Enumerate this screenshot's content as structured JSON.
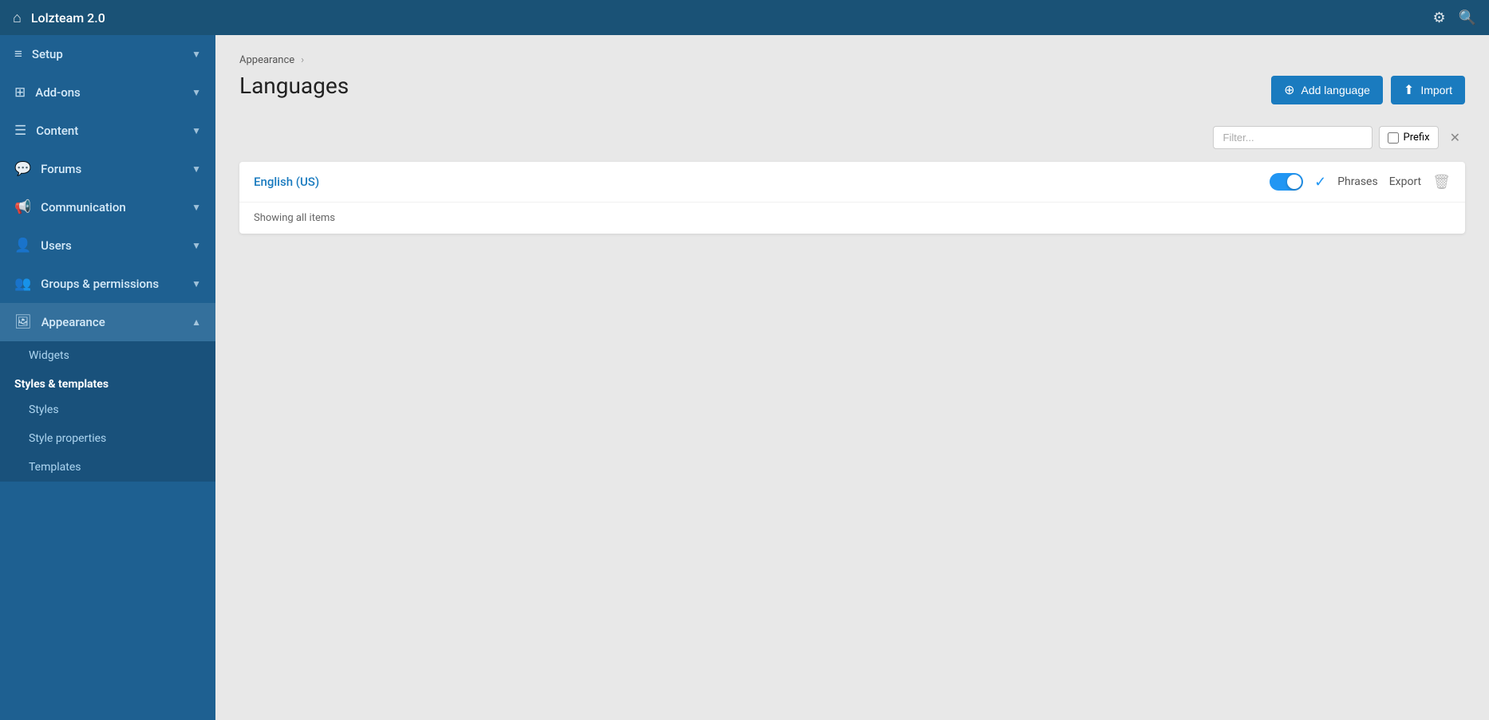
{
  "topbar": {
    "title": "Lolzteam 2.0",
    "home_icon": "⌂",
    "settings_icon": "⚙",
    "search_icon": "🔍"
  },
  "sidebar": {
    "items": [
      {
        "id": "setup",
        "icon": "≡",
        "label": "Setup",
        "expanded": false
      },
      {
        "id": "addons",
        "icon": "⊞",
        "label": "Add-ons",
        "expanded": false
      },
      {
        "id": "content",
        "icon": "☰",
        "label": "Content",
        "expanded": false
      },
      {
        "id": "forums",
        "icon": "💬",
        "label": "Forums",
        "expanded": false
      },
      {
        "id": "communication",
        "icon": "📢",
        "label": "Communication",
        "expanded": false
      },
      {
        "id": "users",
        "icon": "👤",
        "label": "Users",
        "expanded": false
      },
      {
        "id": "groups",
        "icon": "👥",
        "label": "Groups & permissions",
        "expanded": false
      },
      {
        "id": "appearance",
        "icon": "🖼",
        "label": "Appearance",
        "expanded": true
      }
    ],
    "appearance_sub": {
      "widgets_label": "Widgets",
      "styles_templates_header": "Styles & templates",
      "styles_label": "Styles",
      "style_properties_label": "Style properties",
      "templates_label": "Templates"
    }
  },
  "breadcrumb": {
    "parent": "Appearance",
    "separator": "›",
    "current": ""
  },
  "page": {
    "title": "Languages"
  },
  "toolbar": {
    "add_language_label": "Add language",
    "import_label": "Import",
    "filter_placeholder": "Filter...",
    "prefix_label": "Prefix",
    "clear_icon": "✕"
  },
  "languages": [
    {
      "id": "english-us",
      "name": "English (US)",
      "enabled": true,
      "phrases_label": "Phrases",
      "export_label": "Export"
    }
  ],
  "list": {
    "showing_text": "Showing all items"
  }
}
